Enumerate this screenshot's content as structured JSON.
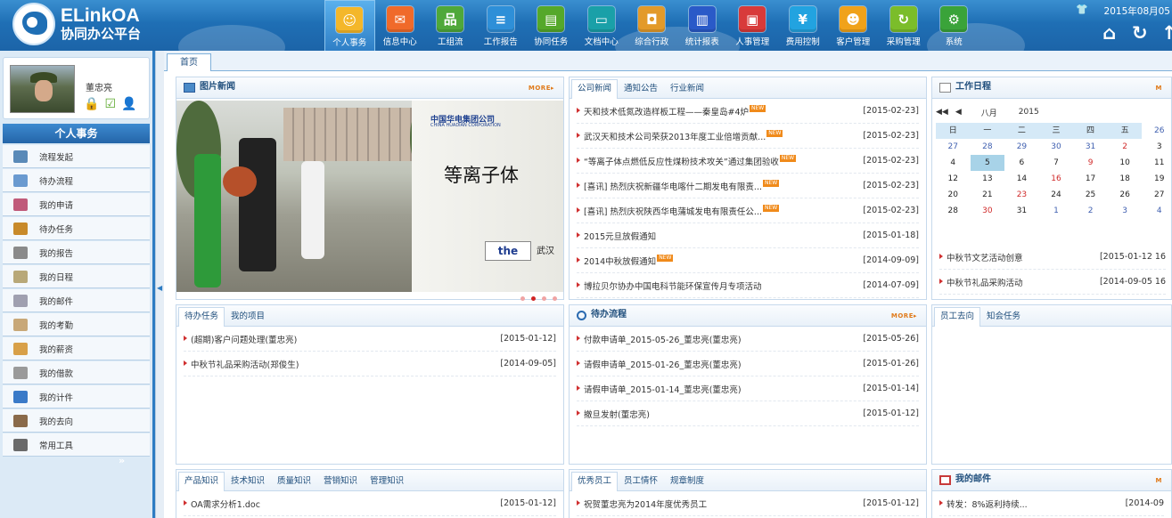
{
  "header": {
    "logo_title": "ELinkOA",
    "logo_subtitle": "协同办公平台",
    "date": "2015年08月05",
    "nav": [
      {
        "label": "个人事务",
        "icon": "person-icon",
        "color": "#f4b72a",
        "active": true
      },
      {
        "label": "信息中心",
        "icon": "message-icon",
        "color": "#f06a2a"
      },
      {
        "label": "工组流",
        "icon": "flow-icon",
        "color": "#4fa83a"
      },
      {
        "label": "工作报告",
        "icon": "report-icon",
        "color": "#2e8fd8"
      },
      {
        "label": "协同任务",
        "icon": "task-icon",
        "color": "#55a82a"
      },
      {
        "label": "文档中心",
        "icon": "folder-icon",
        "color": "#1aa0a8"
      },
      {
        "label": "综合行政",
        "icon": "admin-icon",
        "color": "#e39a2a"
      },
      {
        "label": "统计报表",
        "icon": "chart-icon",
        "color": "#2a5ac8"
      },
      {
        "label": "人事管理",
        "icon": "hr-icon",
        "color": "#d83a3a"
      },
      {
        "label": "费用控制",
        "icon": "yen-icon",
        "color": "#22a3e0"
      },
      {
        "label": "客户管理",
        "icon": "customer-icon",
        "color": "#f0a21a"
      },
      {
        "label": "采购管理",
        "icon": "purchase-icon",
        "color": "#7bbd2a"
      },
      {
        "label": "系统",
        "icon": "gear-icon",
        "color": "#3aa33a"
      }
    ]
  },
  "user": {
    "name": "董忠亮"
  },
  "sidebar": {
    "title": "个人事务",
    "more": "»",
    "items": [
      {
        "label": "流程发起",
        "icon": "refresh-icon",
        "color": "#5a8ab8"
      },
      {
        "label": "待办流程",
        "icon": "org-icon",
        "color": "#6a9ad0"
      },
      {
        "label": "我的申请",
        "icon": "apply-icon",
        "color": "#c05a7a"
      },
      {
        "label": "待办任务",
        "icon": "todo-icon",
        "color": "#c88a2a"
      },
      {
        "label": "我的报告",
        "icon": "report-icon",
        "color": "#8a8a8a"
      },
      {
        "label": "我的日程",
        "icon": "calendar-icon",
        "color": "#b8a878"
      },
      {
        "label": "我的邮件",
        "icon": "mail-icon",
        "color": "#a0a0b0"
      },
      {
        "label": "我的考勤",
        "icon": "attendance-icon",
        "color": "#c8a878"
      },
      {
        "label": "我的薪资",
        "icon": "salary-icon",
        "color": "#d8a048"
      },
      {
        "label": "我的借款",
        "icon": "loan-icon",
        "color": "#9a9a9a"
      },
      {
        "label": "我的计件",
        "icon": "piece-icon",
        "color": "#3a7ac8"
      },
      {
        "label": "我的去向",
        "icon": "whereabouts-icon",
        "color": "#8a6a4a"
      },
      {
        "label": "常用工具",
        "icon": "tools-icon",
        "color": "#6a6a6a"
      }
    ]
  },
  "tabs": {
    "home": "首页"
  },
  "photo_news": {
    "title": "图片新闻",
    "more": "MORE▸",
    "board_company": "中国华电集团公司",
    "board_company_en": "CHINA HUADIAN CORPORATION",
    "board_text": "等离子体",
    "board_logo": "the",
    "board_suffix": "武汉"
  },
  "news": {
    "tabs": [
      "公司新闻",
      "通知公告",
      "行业新闻"
    ],
    "items": [
      {
        "title": "天和技术低氮改造样板工程——秦皇岛#4炉",
        "date": "[2015-02-23]",
        "new": true
      },
      {
        "title": "武汉天和技术公司荣获2013年度工业倍增贡献...",
        "date": "[2015-02-23]",
        "new": true
      },
      {
        "title": "“等离子体点燃低反应性煤粉技术攻关”通过集团验收",
        "date": "[2015-02-23]",
        "new": true
      },
      {
        "title": "[喜讯] 热烈庆祝新疆华电喀什二期发电有限责...",
        "date": "[2015-02-23]",
        "new": true
      },
      {
        "title": "[喜讯] 热烈庆祝陕西华电蒲城发电有限责任公...",
        "date": "[2015-02-23]",
        "new": true
      },
      {
        "title": "2015元旦放假通知",
        "date": "[2015-01-18]",
        "new": false
      },
      {
        "title": "2014中秋放假通知",
        "date": "[2014-09-09]",
        "new": true
      },
      {
        "title": "博拉贝尔协办中国电科节能环保宣传月专项活动",
        "date": "[2014-07-09]",
        "new": false
      }
    ]
  },
  "schedule": {
    "title": "工作日程",
    "more": "M",
    "month": "八月",
    "year": "2015",
    "weekdays": [
      "日",
      "一",
      "二",
      "三",
      "四",
      "五"
    ],
    "weeks": [
      [
        "26",
        "27",
        "28",
        "29",
        "30",
        "31"
      ],
      [
        "2",
        "3",
        "4",
        "5",
        "6",
        "7"
      ],
      [
        "9",
        "10",
        "11",
        "12",
        "13",
        "14"
      ],
      [
        "16",
        "17",
        "18",
        "19",
        "20",
        "21"
      ],
      [
        "23",
        "24",
        "25",
        "26",
        "27",
        "28"
      ],
      [
        "30",
        "31",
        "1",
        "2",
        "3",
        "4"
      ]
    ],
    "today": "5",
    "items": [
      {
        "title": "中秋节文艺活动创意",
        "date": "[2015-01-12 16"
      },
      {
        "title": "中秋节礼品采购活动",
        "date": "[2014-09-05 16"
      }
    ]
  },
  "tasks": {
    "tabs": [
      "待办任务",
      "我的项目"
    ],
    "items": [
      {
        "title": "(超期)客户问题处理(董忠亮)",
        "date": "[2015-01-12]"
      },
      {
        "title": "中秋节礼品采购活动(郑俊生)",
        "date": "[2014-09-05]"
      }
    ]
  },
  "pending": {
    "title": "待办流程",
    "more": "MORE▸",
    "items": [
      {
        "title": "付款申请单_2015-05-26_董忠亮(董忠亮)",
        "date": "[2015-05-26]"
      },
      {
        "title": "请假申请单_2015-01-26_董忠亮(董忠亮)",
        "date": "[2015-01-26]"
      },
      {
        "title": "请假申请单_2015-01-14_董忠亮(董忠亮)",
        "date": "[2015-01-14]"
      },
      {
        "title": "撤旦发射(董忠亮)",
        "date": "[2015-01-12]"
      }
    ]
  },
  "whereabouts": {
    "tabs": [
      "员工去向",
      "知会任务"
    ]
  },
  "knowledge": {
    "tabs": [
      "产品知识",
      "技术知识",
      "质量知识",
      "营销知识",
      "管理知识"
    ],
    "items": [
      {
        "title": "OA需求分析1.doc",
        "date": "[2015-01-12]"
      }
    ]
  },
  "staff": {
    "tabs": [
      "优秀员工",
      "员工情怀",
      "规章制度"
    ],
    "items": [
      {
        "title": "祝贺董忠亮为2014年度优秀员工",
        "date": "[2015-01-12]"
      }
    ]
  },
  "mail": {
    "title": "我的邮件",
    "more": "M",
    "items": [
      {
        "title": "转发：8%返利持续...",
        "date": "[2014-09"
      }
    ]
  }
}
